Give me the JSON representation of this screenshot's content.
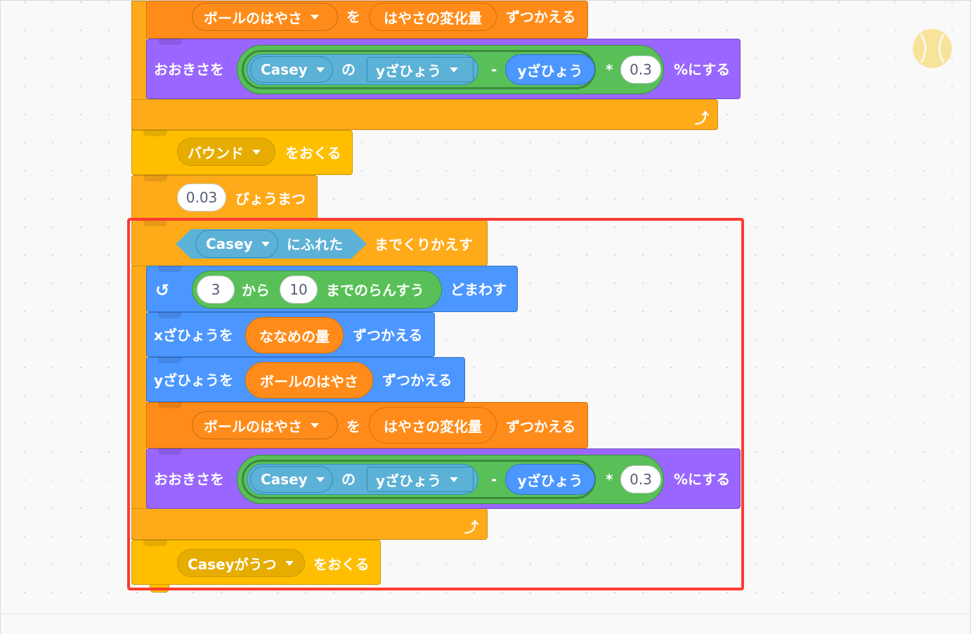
{
  "blocks": {
    "change_speed_1": {
      "var": "ボールのはやさ",
      "to": "を",
      "by": "はやさの変化量",
      "action": "ずつかえる"
    },
    "set_size_1": {
      "label": "おおきさを",
      "sprite": "Casey",
      "of": "の",
      "attr": "yざひょう",
      "minus": "-",
      "rhs": "yざひょう",
      "times": "*",
      "factor": "0.3",
      "suffix": "%にする"
    },
    "broadcast_bound": {
      "msg": "バウンド",
      "action": "をおくる"
    },
    "wait": {
      "value": "0.03",
      "action": "びょうまつ"
    },
    "repeat_until": {
      "sprite": "Casey",
      "touching": "にふれた",
      "action": "までくりかえす"
    },
    "turn": {
      "from_val": "3",
      "from": "から",
      "to_val": "10",
      "range": "までのらんすう",
      "action": "どまわす"
    },
    "change_x": {
      "label": "xざひょうを",
      "var": "ななめの量",
      "action": "ずつかえる"
    },
    "change_y": {
      "label": "yざひょうを",
      "var": "ボールのはやさ",
      "action": "ずつかえる"
    },
    "change_speed_2": {
      "var": "ボールのはやさ",
      "to": "を",
      "by": "はやさの変化量",
      "action": "ずつかえる"
    },
    "set_size_2": {
      "label": "おおきさを",
      "sprite": "Casey",
      "of": "の",
      "attr": "yざひょう",
      "minus": "-",
      "rhs": "yざひょう",
      "times": "*",
      "factor": "0.3",
      "suffix": "%にする"
    },
    "broadcast_casey": {
      "msg": "Caseyがうつ",
      "action": "をおくる"
    }
  },
  "icons": {
    "loop_end": "loop-arrow-icon",
    "turn_left": "rotate-left-icon",
    "sprite_thumb": "ball-icon"
  },
  "colors": {
    "control": "#ffab19",
    "events": "#ffbf00",
    "variables": "#ff8c1a",
    "looks": "#9966ff",
    "motion": "#4c97ff",
    "operators": "#59c059",
    "sensing": "#5cb1d6",
    "highlight": "#ff3b30"
  }
}
